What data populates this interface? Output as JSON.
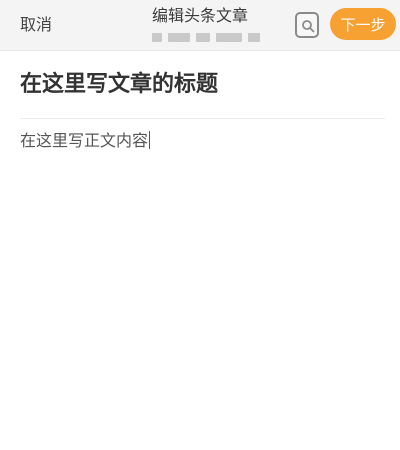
{
  "header": {
    "cancel_label": "取消",
    "title": "编辑头条文章",
    "preview_icon": "preview-search-icon",
    "next_label": "下一步",
    "next_color": "#f7a132"
  },
  "editor": {
    "title_placeholder": "在这里写文章的标题",
    "body_placeholder": "在这里写正文内容"
  }
}
